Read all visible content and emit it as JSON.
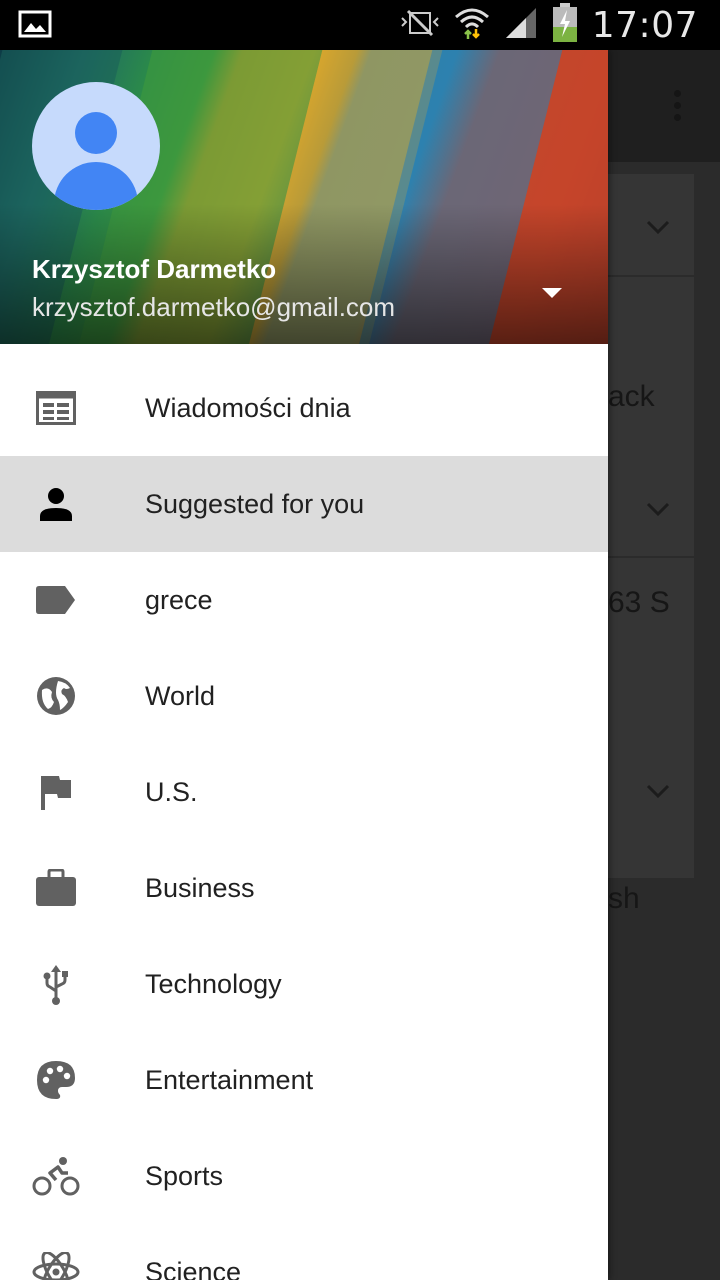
{
  "status_bar": {
    "time": "17:07",
    "icons": [
      "image-icon",
      "no-signal-vibrate-icon",
      "wifi-icon",
      "cellular-signal-icon",
      "battery-charging-icon"
    ]
  },
  "background": {
    "texts": [
      "ack",
      "63 S",
      "sh"
    ]
  },
  "drawer": {
    "account": {
      "name": "Krzysztof Darmetko",
      "email": "krzysztof.darmetko@gmail.com"
    },
    "items": [
      {
        "label": "Wiadomości dnia",
        "icon": "newspaper-icon"
      },
      {
        "label": "Suggested for you",
        "icon": "person-icon",
        "selected": true
      },
      {
        "label": "grece",
        "icon": "label-tag-icon"
      },
      {
        "label": "World",
        "icon": "globe-icon"
      },
      {
        "label": "U.S.",
        "icon": "flag-icon"
      },
      {
        "label": "Business",
        "icon": "briefcase-icon"
      },
      {
        "label": "Technology",
        "icon": "usb-icon"
      },
      {
        "label": "Entertainment",
        "icon": "palette-icon"
      },
      {
        "label": "Sports",
        "icon": "bike-icon"
      },
      {
        "label": "Science",
        "icon": "atom-icon"
      }
    ]
  },
  "colors": {
    "icon_gray": "#616161",
    "selected_bg": "#dcdcdc",
    "avatar_blue": "#4285f4",
    "avatar_bg": "#c6dafc"
  }
}
